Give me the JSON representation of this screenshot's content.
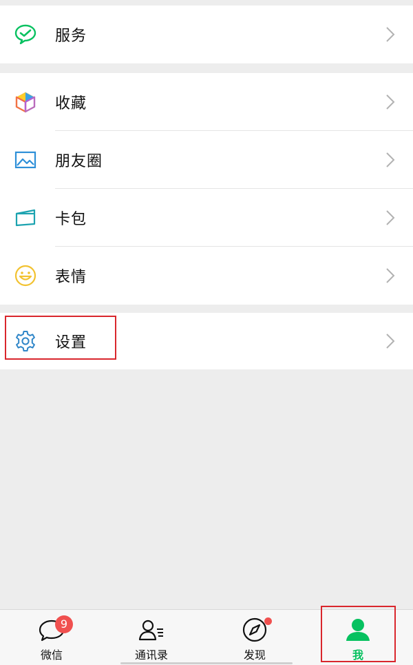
{
  "menu": {
    "service": {
      "label": "服务",
      "icon": "wechat-pay-icon"
    },
    "favorites": {
      "label": "收藏",
      "icon": "cube-icon"
    },
    "moments": {
      "label": "朋友圈",
      "icon": "picture-icon"
    },
    "cards": {
      "label": "卡包",
      "icon": "card-icon"
    },
    "stickers": {
      "label": "表情",
      "icon": "smile-icon"
    },
    "settings": {
      "label": "设置",
      "icon": "gear-icon"
    }
  },
  "tabbar": {
    "chats": {
      "label": "微信",
      "badge": "9",
      "icon": "chat-bubble-icon"
    },
    "contacts": {
      "label": "通讯录",
      "icon": "contacts-icon"
    },
    "discover": {
      "label": "发现",
      "icon": "compass-icon",
      "has_dot": true
    },
    "me": {
      "label": "我",
      "icon": "person-icon",
      "active": true
    }
  },
  "colors": {
    "accent": "#07c160",
    "highlight": "#d9262c",
    "badge": "#f0504f",
    "background": "#ededed"
  }
}
